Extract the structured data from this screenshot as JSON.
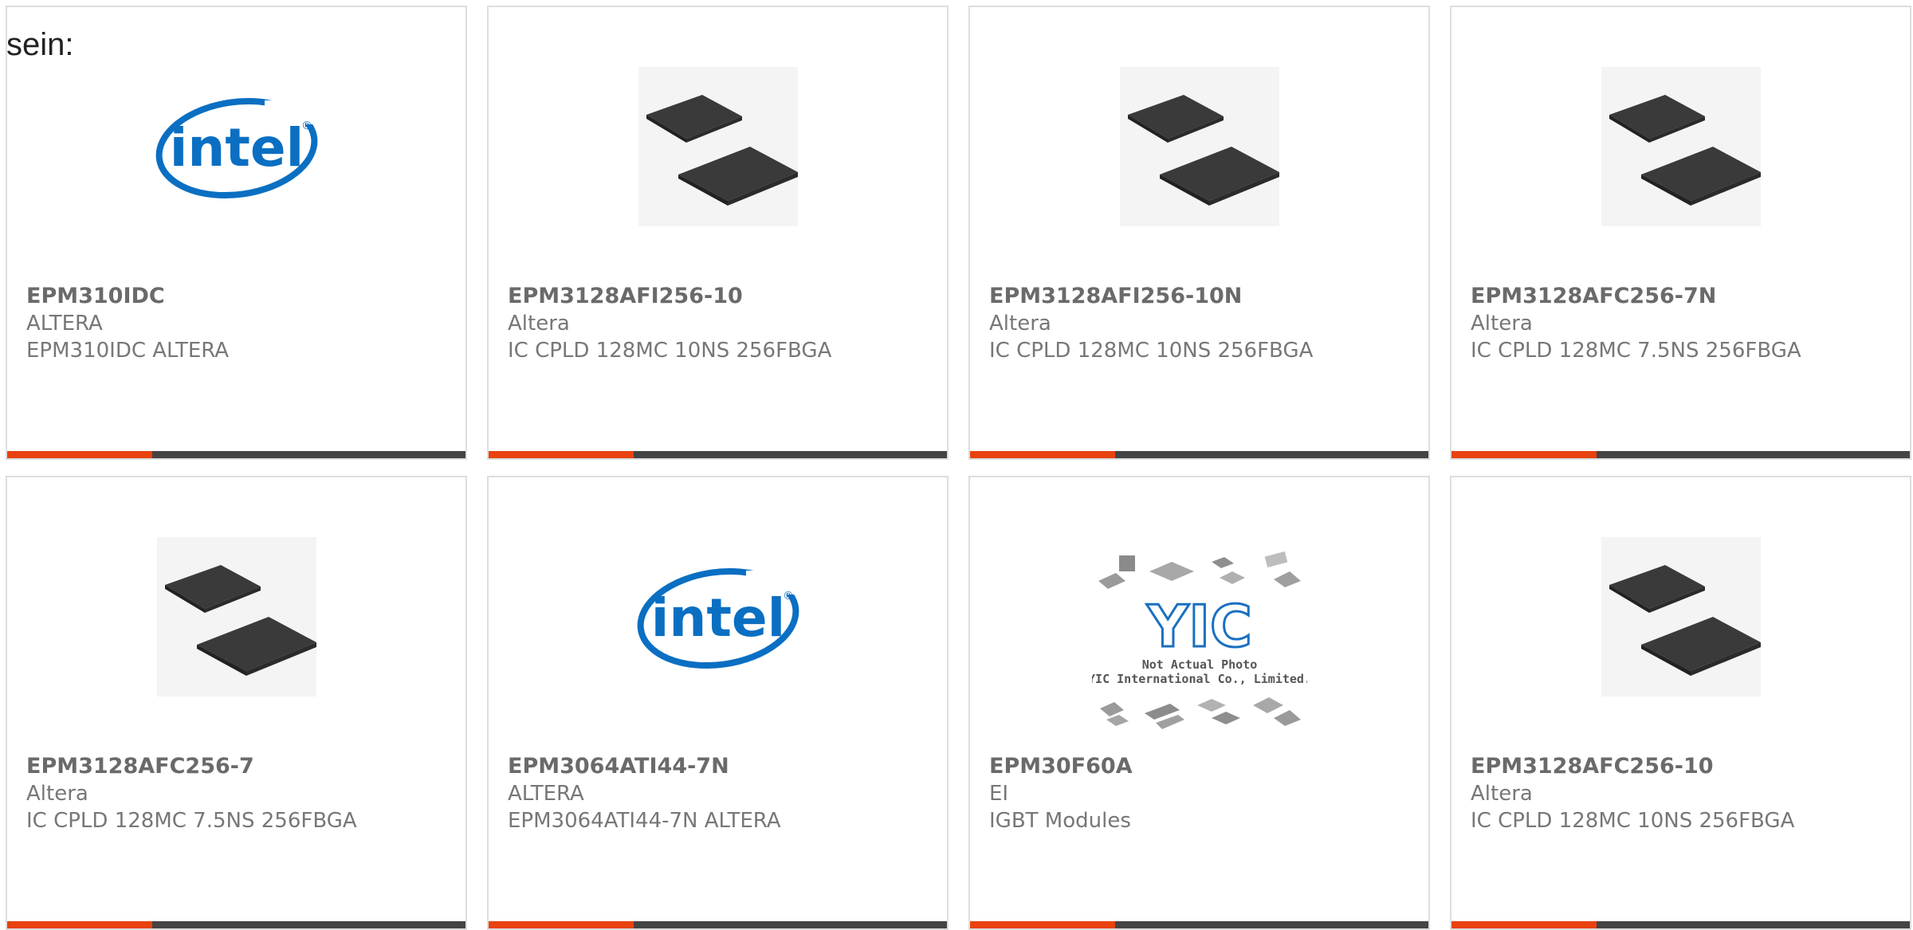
{
  "intro_text": "sein:",
  "colors": {
    "accent": "#e8420f",
    "bar": "#444444",
    "border": "#dddddd",
    "intel_blue": "#0a6fc2"
  },
  "products": [
    {
      "part": "EPM310IDC",
      "manufacturer": "ALTERA",
      "description": "EPM310IDC ALTERA",
      "image": "intel-logo"
    },
    {
      "part": "EPM3128AFI256-10",
      "manufacturer": "Altera",
      "description": "IC CPLD 128MC 10NS 256FBGA",
      "image": "bga-chip"
    },
    {
      "part": "EPM3128AFI256-10N",
      "manufacturer": "Altera",
      "description": "IC CPLD 128MC 10NS 256FBGA",
      "image": "bga-chip"
    },
    {
      "part": "EPM3128AFC256-7N",
      "manufacturer": "Altera",
      "description": "IC CPLD 128MC 7.5NS 256FBGA",
      "image": "bga-chip"
    },
    {
      "part": "EPM3128AFC256-7",
      "manufacturer": "Altera",
      "description": "IC CPLD 128MC 7.5NS 256FBGA",
      "image": "bga-chip"
    },
    {
      "part": "EPM3064ATI44-7N",
      "manufacturer": "ALTERA",
      "description": "EPM3064ATI44-7N ALTERA",
      "image": "intel-logo"
    },
    {
      "part": "EPM30F60A",
      "manufacturer": "EI",
      "description": "IGBT Modules",
      "image": "yic-placeholder"
    },
    {
      "part": "EPM3128AFC256-10",
      "manufacturer": "Altera",
      "description": "IC CPLD 128MC 10NS 256FBGA",
      "image": "bga-chip"
    }
  ],
  "logo_texts": {
    "intel": "intel",
    "yic_mark": "YIC",
    "yic_line1": "Not Actual Photo",
    "yic_line2": "YIC International Co., Limited."
  }
}
